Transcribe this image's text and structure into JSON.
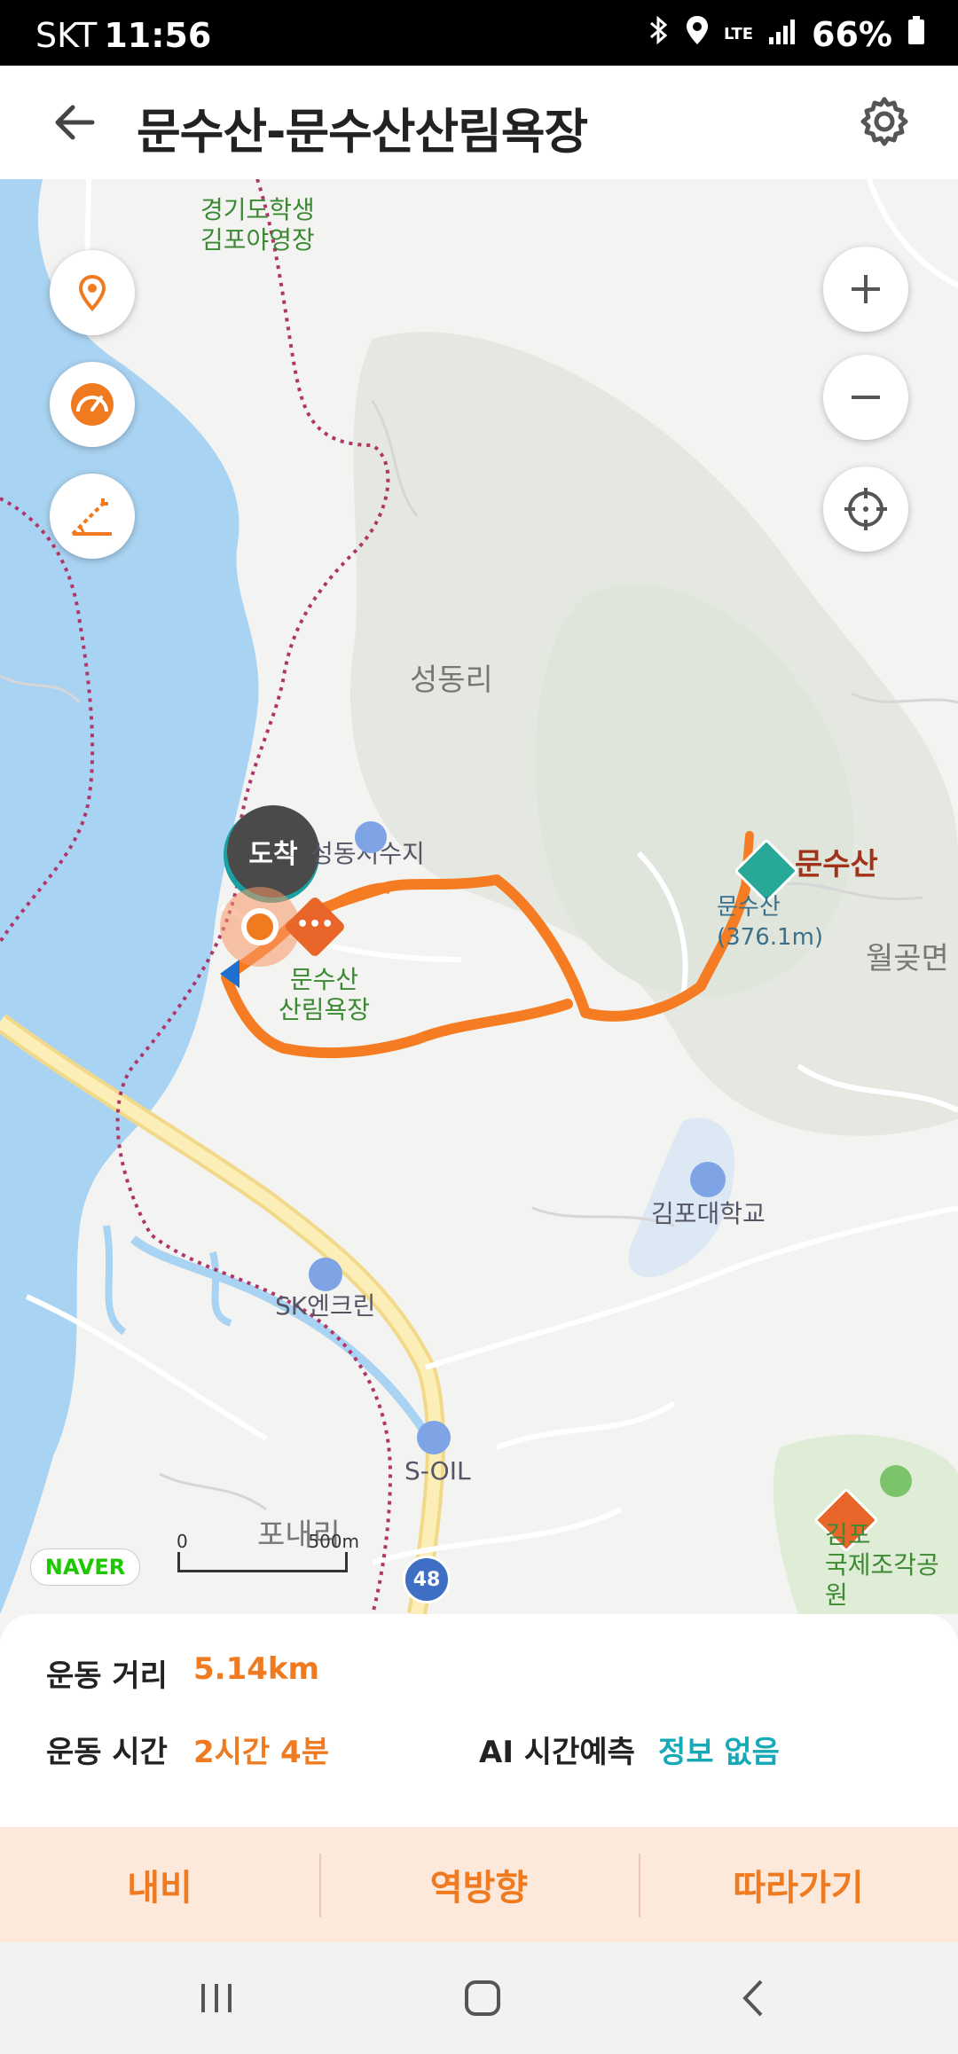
{
  "status_bar": {
    "carrier": "SKT",
    "time": "11:56",
    "network": "LTE",
    "battery": "66%"
  },
  "header": {
    "title": "문수산-문수산산림욕장"
  },
  "map": {
    "labels": {
      "camp": "경기도학생\n김포야영장",
      "village": "성동리",
      "arrival": "도착",
      "reservoir": "성동저수지",
      "forest": "문수산\n산림욕장",
      "summit_name": "문수산",
      "summit_detail": "문수산\n(376.1m)",
      "area": "월곶면",
      "university": "김포대학교",
      "gas1": "SK엔크린",
      "gas2": "S-OIL",
      "pone": "포내리",
      "park": "김포\n국제조각공원",
      "route_no": "48",
      "naver": "NAVER",
      "scale_zero": "0",
      "scale_500": "500m"
    }
  },
  "stats": {
    "distance_label": "운동 거리",
    "distance_value": "5.14km",
    "time_label": "운동 시간",
    "time_value": "2시간 4분",
    "ai_label": "AI 시간예측",
    "ai_value": "정보 없음"
  },
  "actions": {
    "navigate": "내비",
    "reverse": "역방향",
    "follow": "따라가기"
  },
  "colors": {
    "accent": "#f07a1f",
    "ai": "#16a9b8",
    "water": "#a9d3f2",
    "route": "#f57c22"
  }
}
